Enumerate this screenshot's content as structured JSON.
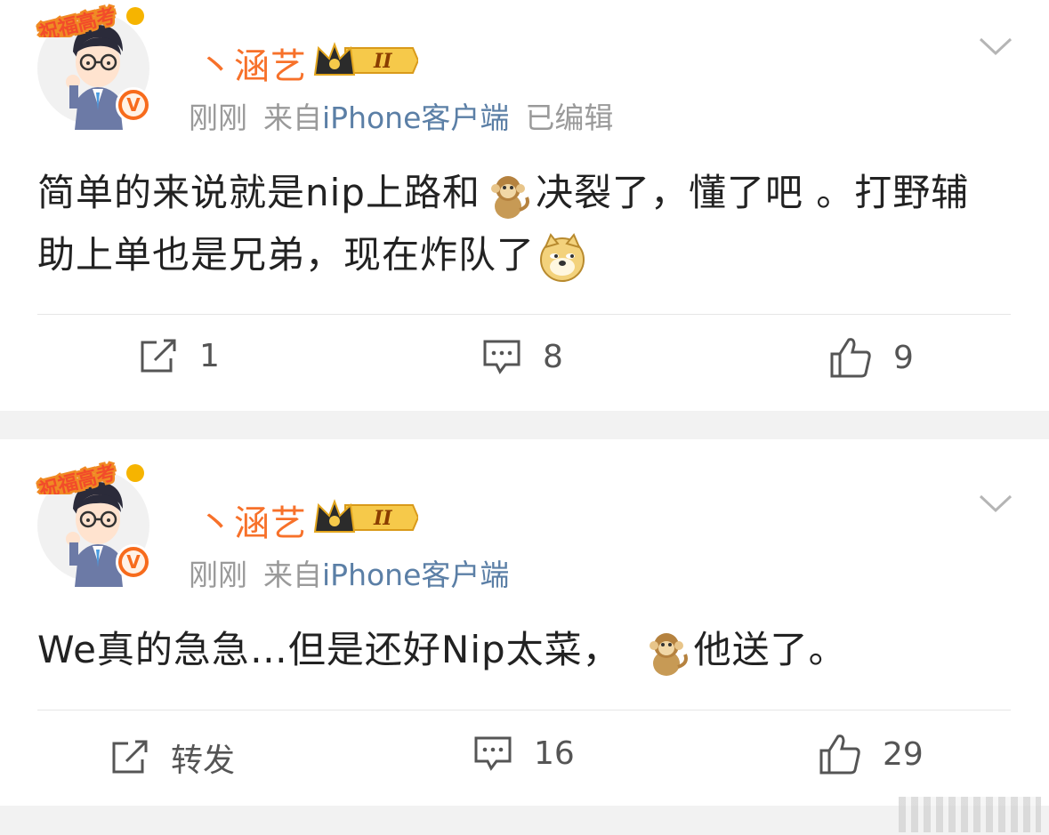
{
  "posts": [
    {
      "username": "丶涵艺",
      "rank_badge": "II",
      "avatar_banner": "祝福高考",
      "time": "刚刚",
      "source_prefix": "来自",
      "source_app": "iPhone客户端",
      "edited": "已编辑",
      "content_before_emoji": "简单的来说就是nip上路和",
      "content_emoji": "monkey-emoji",
      "content_after_emoji": "决裂了，懂了吧 。打野辅助上单也是兄弟，现在炸队了",
      "content_trailing_emoji": "doge-emoji",
      "repost_label": "1",
      "comment_count": "8",
      "like_count": "9"
    },
    {
      "username": "丶涵艺",
      "rank_badge": "II",
      "avatar_banner": "祝福高考",
      "time": "刚刚",
      "source_prefix": "来自",
      "source_app": "iPhone客户端",
      "content_before_emoji": "We真的急急…但是还好Nip太菜，",
      "content_emoji": "monkey-emoji",
      "content_after_emoji": "他送了。",
      "repost_label": "转发",
      "comment_count": "16",
      "like_count": "29"
    }
  ],
  "colors": {
    "username": "#f7712a",
    "source_link": "#5b7fa6",
    "meta_gray": "#9a9a9a",
    "verified_badge": "#f76b1c",
    "page_bg": "#f2f2f2"
  },
  "icons": [
    "chevron-down-icon",
    "repost-icon",
    "comment-icon",
    "like-icon",
    "verified-badge-icon",
    "crown-rank-icon"
  ]
}
